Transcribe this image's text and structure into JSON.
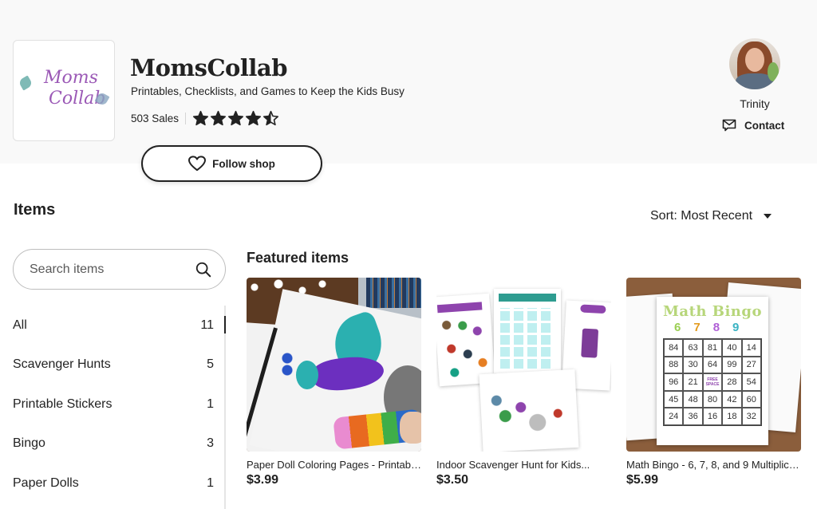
{
  "shop": {
    "logo_text_line1": "Moms",
    "logo_text_line2": "Collab",
    "name": "MomsCollab",
    "tagline": "Printables, Checklists, and Games to Keep the Kids Busy",
    "sales": "503 Sales",
    "rating": 4.5,
    "rating_max": 5,
    "follow_label": "Follow shop",
    "follow_icon": "heart-outline-icon"
  },
  "owner": {
    "name": "Trinity",
    "contact_label": "Contact",
    "contact_icon": "message-icon"
  },
  "items": {
    "title": "Items",
    "sort_label": "Sort: Most Recent",
    "search": {
      "placeholder": "Search items",
      "value": "",
      "icon": "search-icon"
    },
    "sections": [
      {
        "label": "All",
        "count": "11",
        "active": true
      },
      {
        "label": "Scavenger Hunts",
        "count": "5",
        "active": false
      },
      {
        "label": "Printable Stickers",
        "count": "1",
        "active": false
      },
      {
        "label": "Bingo",
        "count": "3",
        "active": false
      },
      {
        "label": "Paper Dolls",
        "count": "1",
        "active": false
      }
    ]
  },
  "featured": {
    "title": "Featured items",
    "listings": [
      {
        "title": "Paper Doll Coloring Pages - Printable...",
        "price": "$3.99"
      },
      {
        "title": "Indoor Scavenger Hunt for Kids...",
        "price": "$3.50"
      },
      {
        "title": "Math Bingo - 6, 7, 8, and 9 Multiplication...",
        "price": "$5.99",
        "image_text": {
          "heading": "Math Bingo",
          "numbers": [
            "6",
            "7",
            "8",
            "9"
          ],
          "grid": [
            "84",
            "63",
            "81",
            "40",
            "14",
            "88",
            "30",
            "64",
            "99",
            "27",
            "96",
            "21",
            "FREE SPACE",
            "28",
            "54",
            "45",
            "48",
            "80",
            "42",
            "60",
            "24",
            "36",
            "16",
            "18",
            "32"
          ]
        }
      }
    ]
  },
  "colors": {
    "text": "#222222",
    "header_bg": "#f9f9f9",
    "logo_purple": "#9b59b6",
    "bingo_colors": [
      "#9bcf53",
      "#e39b1f",
      "#b05fd6",
      "#3bb3c3"
    ]
  }
}
